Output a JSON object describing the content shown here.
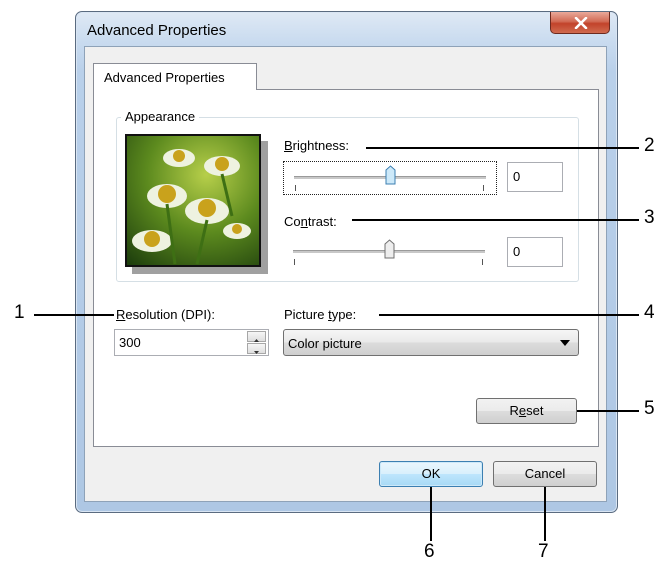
{
  "window": {
    "title": "Advanced Properties",
    "close_icon": "close-icon"
  },
  "tab": {
    "label": "Advanced Properties"
  },
  "appearance": {
    "group_label": "Appearance",
    "thumbnail_icon": "flower-photo-thumbnail",
    "brightness": {
      "label_pre": "",
      "label_accel": "B",
      "label_post": "rightness:",
      "value": "0",
      "slider_fraction": 0.5
    },
    "contrast": {
      "label_pre": "Co",
      "label_accel": "n",
      "label_post": "trast:",
      "value": "0",
      "slider_fraction": 0.5
    }
  },
  "resolution": {
    "label_pre": "",
    "label_accel": "R",
    "label_post": "esolution (DPI):",
    "value": "300"
  },
  "picture_type": {
    "label_pre": "Picture ",
    "label_accel": "t",
    "label_post": "ype:",
    "selected": "Color picture"
  },
  "buttons": {
    "reset_pre": "R",
    "reset_accel": "e",
    "reset_post": "set",
    "ok": "OK",
    "cancel": "Cancel"
  },
  "callouts": [
    "1",
    "2",
    "3",
    "4",
    "5",
    "6",
    "7"
  ],
  "colors": {
    "accent_button": "#3c7fb1",
    "close_button": "#c2432a",
    "window_frame": "#b9d0ea"
  }
}
